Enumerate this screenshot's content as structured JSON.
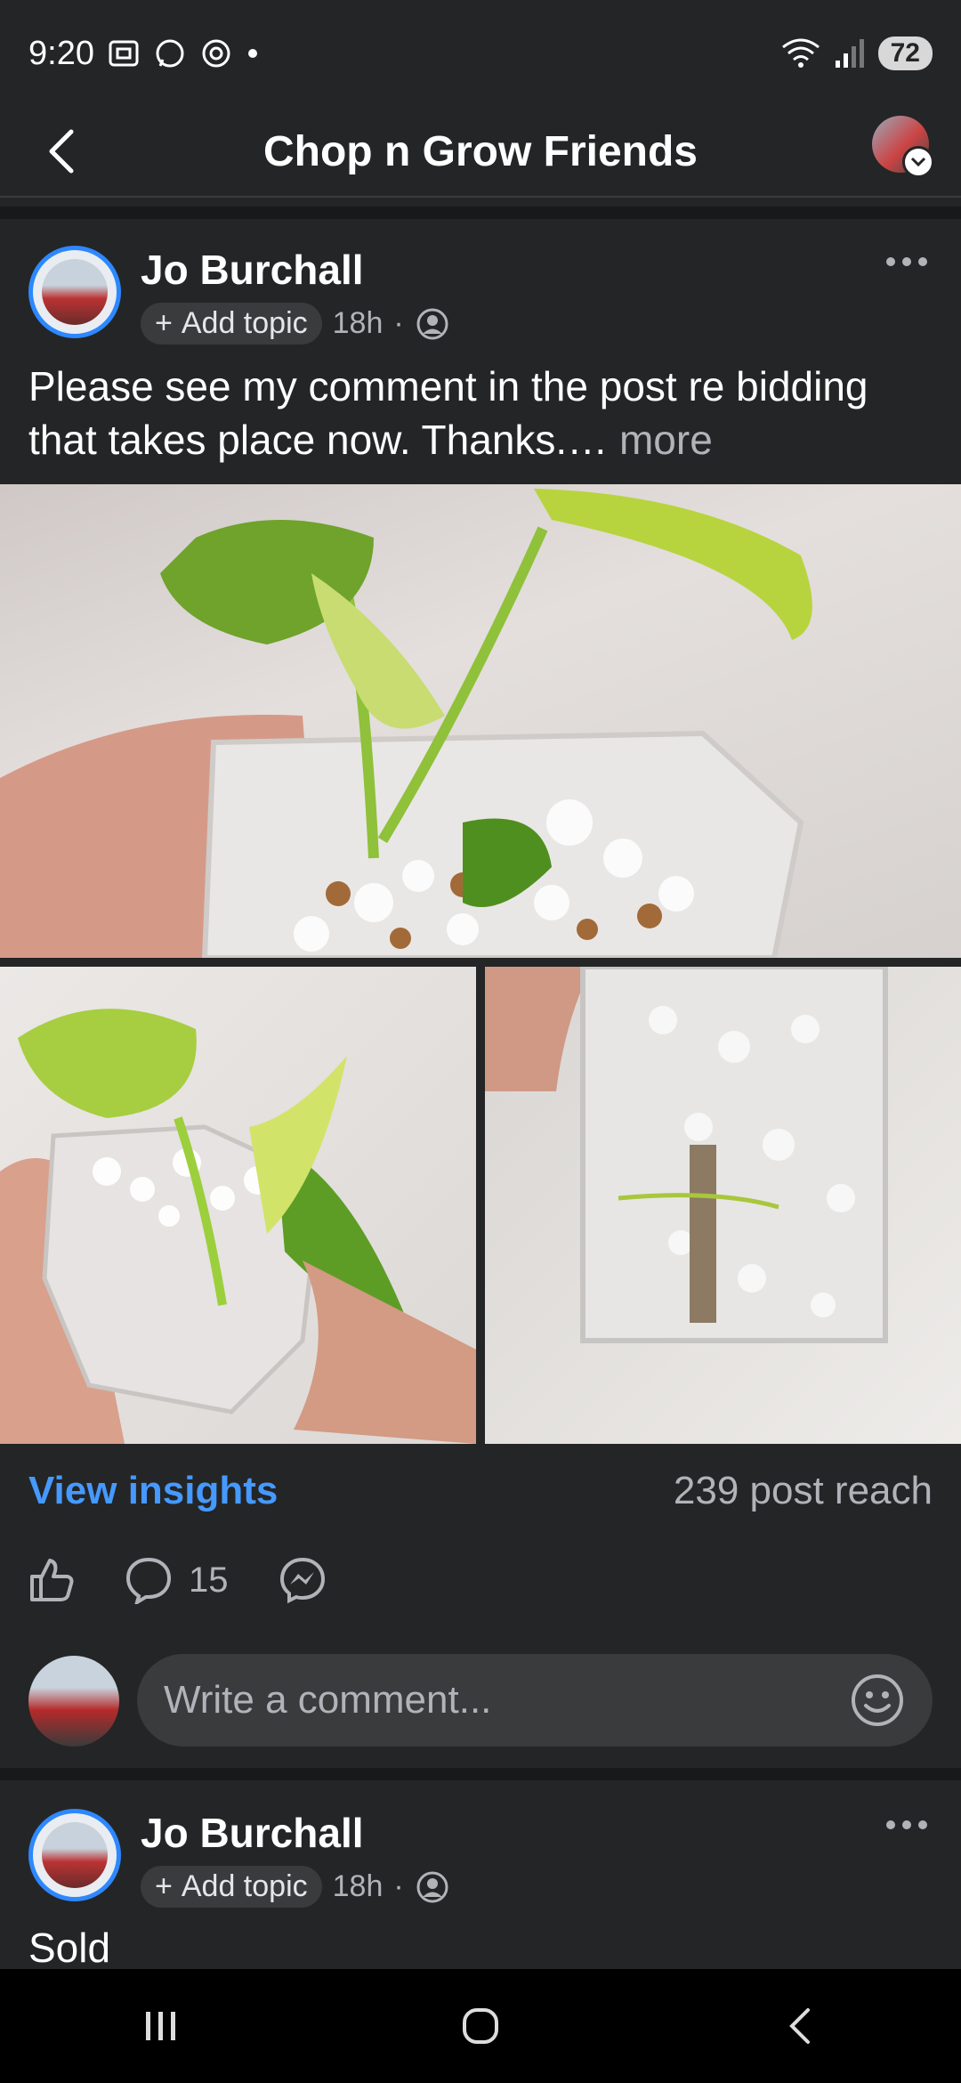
{
  "status_bar": {
    "time": "9:20",
    "battery": "72"
  },
  "app_bar": {
    "title": "Chop n Grow Friends"
  },
  "posts": [
    {
      "author": "Jo Burchall",
      "topic_label": "Add topic",
      "time": "18h",
      "text": "Please see my comment in the post re bidding that takes place now. Thanks.…",
      "more_label": "more",
      "insights_label": "View insights",
      "reach": "239 post reach",
      "comment_count": "15",
      "comment_placeholder": "Write a comment..."
    },
    {
      "author": "Jo Burchall",
      "topic_label": "Add topic",
      "time": "18h",
      "text": "Sold"
    }
  ],
  "icons": {
    "status_left": [
      "screenshot-icon",
      "whatsapp-icon",
      "threads-icon",
      "notification-dot-icon"
    ],
    "status_right": [
      "wifi-icon",
      "signal-icon",
      "battery-icon"
    ],
    "post": [
      "more-options-icon",
      "privacy-members-icon",
      "plus-icon"
    ],
    "actions": [
      "like-icon",
      "comment-icon",
      "messenger-share-icon"
    ],
    "nav": [
      "recent-apps-icon",
      "home-icon",
      "back-icon"
    ]
  },
  "colors": {
    "background": "#242526",
    "accent": "#4599ff",
    "avatar_ring": "#2d88ff"
  }
}
